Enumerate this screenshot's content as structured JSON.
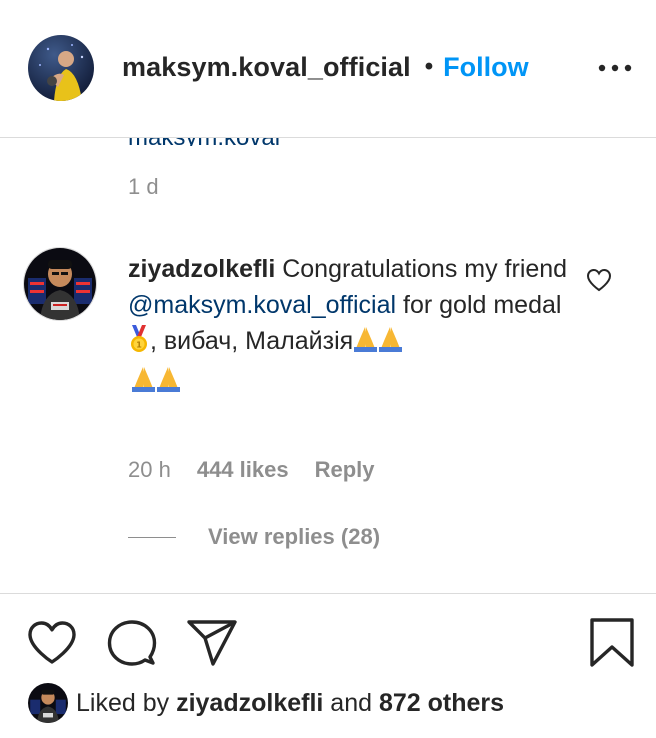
{
  "header": {
    "username": "maksym.koval_official",
    "separator": "•",
    "follow_label": "Follow",
    "more_icon": "more-horizontal-icon"
  },
  "previous_comment": {
    "cutoff_text": "maksym.koval_official",
    "time": "1 d"
  },
  "comment": {
    "username": "ziyadzolkefli",
    "text_part1": "Congratulations my friend",
    "mention": "@maksym.koval_official",
    "text_part2": "for gold medal",
    "emoji_medal": "🥇",
    "text_part3": ", вибач, Малайзія",
    "emoji_pray": "🙏",
    "time": "20 h",
    "likes": "444 likes",
    "reply_label": "Reply",
    "view_replies_label": "View replies (28)"
  },
  "actions": {
    "like_icon": "heart-icon",
    "comment_icon": "comment-icon",
    "share_icon": "share-icon",
    "save_icon": "bookmark-icon"
  },
  "liked_by": {
    "prefix": "Liked by",
    "user": "ziyadzolkefli",
    "conj": "and",
    "others": "872 others"
  },
  "colors": {
    "follow": "#0095f6",
    "mention": "#00376b",
    "secondary_text": "#8e8e8e",
    "primary_text": "#262626",
    "divider": "#dbdbdb"
  }
}
